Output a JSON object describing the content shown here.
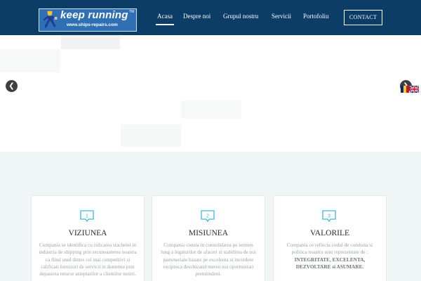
{
  "colors": {
    "header": "#0b3d66",
    "accent": "#3fb6dc",
    "section_bg": "#f0f5f6"
  },
  "header": {
    "logo": {
      "title": "keep running",
      "subtitle": "www.ships-repairs.com",
      "tm": "TM"
    },
    "nav": [
      {
        "label": "Acasa",
        "active": true
      },
      {
        "label": "Despre noi"
      },
      {
        "label": "Grupul nostru"
      },
      {
        "label": "Servicii"
      },
      {
        "label": "Portofoliu"
      }
    ],
    "contact_label": "CONTACT"
  },
  "slider": {
    "prev_icon": "chevron-left-icon",
    "next_icon": "chevron-right-icon",
    "languages": [
      "ro",
      "en"
    ]
  },
  "features": [
    {
      "number": "1",
      "title": "VIZIUNEA",
      "text": "Compania se identifica cu ridicarea stachetei in industria de shipping prin recunoasterea noastra ca fiind unul dintre cei mai competitivi si calificati furnizori de servicii in domeniu prin depasirea tuturor asteptarilor a clientilor nostri."
    },
    {
      "number": "2",
      "title": "MISIUNEA",
      "text": "Compania consta in consolidarea pe termen lung a legaturilor de afaceri si stabilirea de noi parteneriate bazate pe excelenta si incredere reciproca deschizand mereu noi oportunitati pretutindeni."
    },
    {
      "number": "3",
      "title": "VALORILE",
      "text_intro": "Compania ce reflecta codul de conduita si politica noastra sunt reprezentate de :",
      "text_values": "INTEGRITATE, EXCELENTA, DEZVOLTARE si ASUMARE."
    }
  ]
}
